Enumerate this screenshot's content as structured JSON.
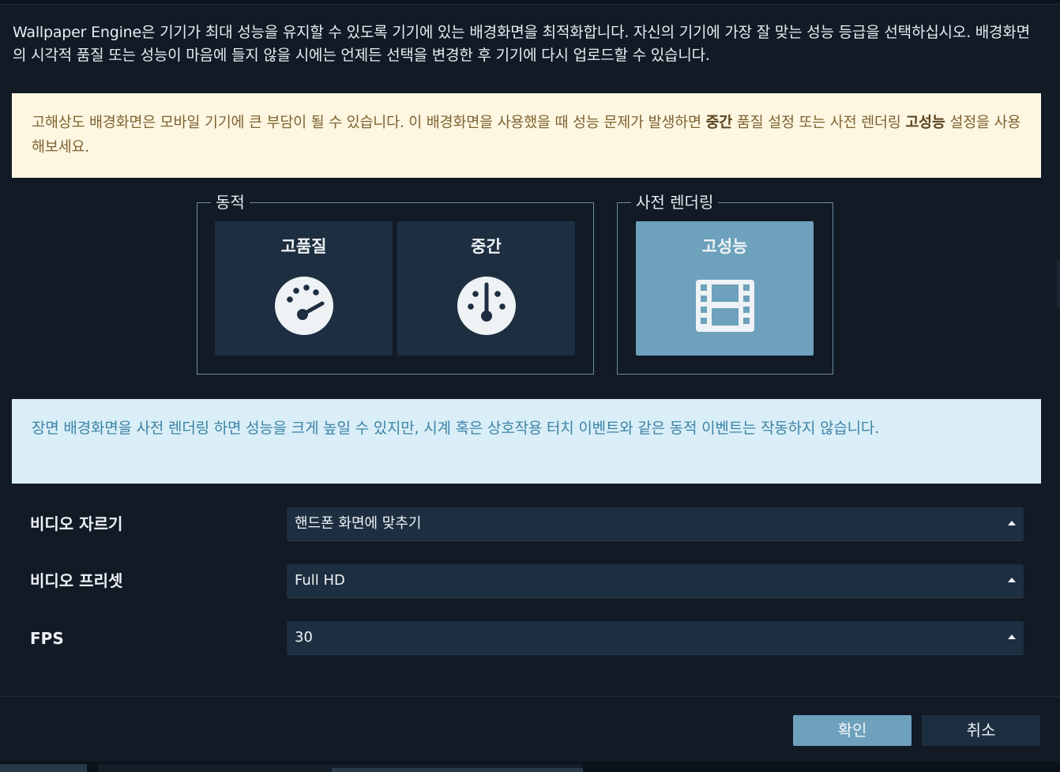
{
  "intro_text": "Wallpaper Engine은 기기가 최대 성능을 유지할 수 있도록 기기에 있는 배경화면을 최적화합니다. 자신의 기기에 가장 잘 맞는 성능 등급을 선택하십시오. 배경화면의 시각적 품질 또는 성능이 마음에 들지 않을 시에는 언제든 선택을 변경한 후 기기에 다시 업로드할 수 있습니다.",
  "warning": {
    "part1": "고해상도 배경화면은 모바일 기기에 큰 부담이 될 수 있습니다. 이 배경화면을 사용했을 때 성능 문제가 발생하면 ",
    "bold1": "중간",
    "part2": " 품질 설정 또는 사전 렌더링 ",
    "bold2": "고성능",
    "part3": " 설정을 사용해보세요."
  },
  "groups": {
    "dynamic_label": "동적",
    "prerender_label": "사전 렌더링"
  },
  "options": {
    "high_quality": "고품질",
    "medium": "중간",
    "high_performance": "고성능",
    "selected": "high_performance"
  },
  "icons": {
    "high_quality": "gauge-high-icon",
    "medium": "gauge-mid-icon",
    "high_performance": "film-icon"
  },
  "info_text": "장면 배경화면을 사전 렌더링 하면 성능을 크게 높일 수 있지만, 시계 혹은 상호작용 터치 이벤트와 같은 동적 이벤트는 작동하지 않습니다.",
  "settings": {
    "video_crop": {
      "label": "비디오 자르기",
      "value": "핸드폰 화면에 맞추기"
    },
    "video_preset": {
      "label": "비디오 프리셋",
      "value": "Full HD"
    },
    "fps": {
      "label": "FPS",
      "value": "30"
    }
  },
  "buttons": {
    "confirm": "확인",
    "cancel": "취소"
  },
  "colors": {
    "background": "#111a25",
    "tile": "#1d2e40",
    "accent": "#6da1bc",
    "warning_bg": "#fdf6e1",
    "info_bg": "#d9eef7"
  }
}
